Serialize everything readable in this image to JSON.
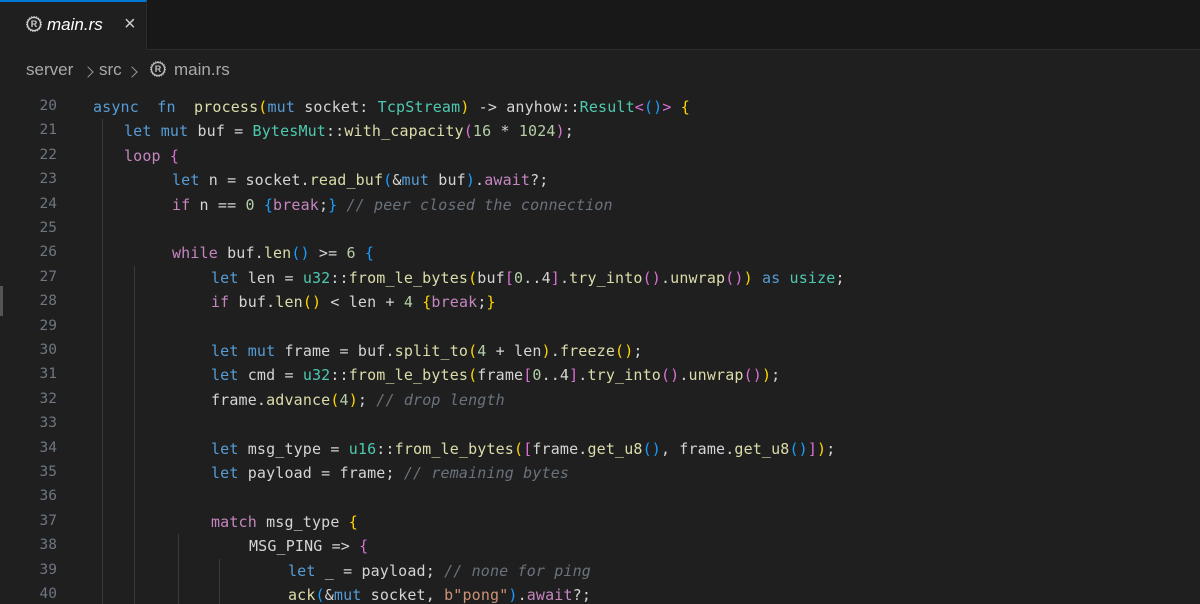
{
  "tab": {
    "filename": "main.rs",
    "close_label": "×"
  },
  "breadcrumb": {
    "items": [
      "server",
      "src",
      "main.rs"
    ]
  },
  "editor": {
    "lines": [
      {
        "n": "20",
        "indent": 0,
        "tokens": [
          [
            "kb",
            "async"
          ],
          [
            "",
            "  "
          ],
          [
            "kb",
            "fn"
          ],
          [
            "",
            "  "
          ],
          [
            "fn",
            "process"
          ],
          [
            "bY",
            "("
          ],
          [
            "kb",
            "mut"
          ],
          [
            "",
            " socket: "
          ],
          [
            "ty",
            "TcpStream"
          ],
          [
            "bY",
            ")"
          ],
          [
            "",
            " -> anyhow::"
          ],
          [
            "ty",
            "Result"
          ],
          [
            "bP",
            "<"
          ],
          [
            "bB",
            "()"
          ],
          [
            "bP",
            ">"
          ],
          [
            "",
            " "
          ],
          [
            "bY",
            "{"
          ]
        ]
      },
      {
        "n": "21",
        "indent": 1,
        "tokens": [
          [
            "kb",
            "let"
          ],
          [
            "",
            " "
          ],
          [
            "kb",
            "mut"
          ],
          [
            "",
            " buf = "
          ],
          [
            "ty",
            "BytesMut"
          ],
          [
            "",
            "::"
          ],
          [
            "fn",
            "with_capacity"
          ],
          [
            "bP",
            "("
          ],
          [
            "num",
            "16"
          ],
          [
            "",
            " * "
          ],
          [
            "num",
            "1024"
          ],
          [
            "bP",
            ")"
          ],
          [
            "",
            ";"
          ]
        ]
      },
      {
        "n": "22",
        "indent": 1,
        "tokens": [
          [
            "kw",
            "loop"
          ],
          [
            "",
            " "
          ],
          [
            "bP",
            "{"
          ]
        ]
      },
      {
        "n": "23",
        "indent": 2,
        "tokens": [
          [
            "kb",
            "let"
          ],
          [
            "",
            " n = socket."
          ],
          [
            "fn",
            "read_buf"
          ],
          [
            "bB",
            "("
          ],
          [
            "",
            "&"
          ],
          [
            "kb",
            "mut"
          ],
          [
            "",
            " buf"
          ],
          [
            "bB",
            ")"
          ],
          [
            "",
            "."
          ],
          [
            "kw",
            "await"
          ],
          [
            "",
            "?;"
          ]
        ]
      },
      {
        "n": "24",
        "indent": 2,
        "tokens": [
          [
            "kw",
            "if"
          ],
          [
            "",
            " n == "
          ],
          [
            "num",
            "0"
          ],
          [
            "",
            " "
          ],
          [
            "bB",
            "{"
          ],
          [
            "kw",
            "break"
          ],
          [
            "",
            ";"
          ],
          [
            "bB",
            "}"
          ],
          [
            "",
            " "
          ],
          [
            "cm",
            "// peer closed the connection"
          ]
        ]
      },
      {
        "n": "25",
        "indent": 0,
        "tokens": []
      },
      {
        "n": "26",
        "indent": 2,
        "tokens": [
          [
            "kw",
            "while"
          ],
          [
            "",
            " buf."
          ],
          [
            "fn",
            "len"
          ],
          [
            "bB",
            "()"
          ],
          [
            "",
            " >= "
          ],
          [
            "num",
            "6"
          ],
          [
            "",
            " "
          ],
          [
            "bB",
            "{"
          ]
        ]
      },
      {
        "n": "27",
        "indent": 3,
        "tokens": [
          [
            "kb",
            "let"
          ],
          [
            "",
            " len = "
          ],
          [
            "ty",
            "u32"
          ],
          [
            "",
            "::"
          ],
          [
            "fn",
            "from_le_bytes"
          ],
          [
            "bY",
            "("
          ],
          [
            "",
            "buf"
          ],
          [
            "bP",
            "["
          ],
          [
            "num",
            "0"
          ],
          [
            "",
            "..4"
          ],
          [
            "bP",
            "]"
          ],
          [
            "",
            "."
          ],
          [
            "fn",
            "try_into"
          ],
          [
            "bP",
            "()"
          ],
          [
            "",
            "."
          ],
          [
            "fn",
            "unwrap"
          ],
          [
            "bP",
            "()"
          ],
          [
            "bY",
            ")"
          ],
          [
            "",
            " "
          ],
          [
            "kb",
            "as"
          ],
          [
            "",
            " "
          ],
          [
            "ty",
            "usize"
          ],
          [
            "",
            ";"
          ]
        ]
      },
      {
        "n": "28",
        "indent": 3,
        "tokens": [
          [
            "kw",
            "if"
          ],
          [
            "",
            " buf."
          ],
          [
            "fn",
            "len"
          ],
          [
            "bY",
            "()"
          ],
          [
            "",
            " < len + "
          ],
          [
            "num",
            "4"
          ],
          [
            "",
            " "
          ],
          [
            "bY",
            "{"
          ],
          [
            "kw",
            "break"
          ],
          [
            "",
            ";"
          ],
          [
            "bY",
            "}"
          ]
        ]
      },
      {
        "n": "29",
        "indent": 0,
        "tokens": []
      },
      {
        "n": "30",
        "indent": 3,
        "tokens": [
          [
            "kb",
            "let"
          ],
          [
            "",
            " "
          ],
          [
            "kb",
            "mut"
          ],
          [
            "",
            " frame = buf."
          ],
          [
            "fn",
            "split_to"
          ],
          [
            "bY",
            "("
          ],
          [
            "num",
            "4"
          ],
          [
            "",
            " + len"
          ],
          [
            "bY",
            ")"
          ],
          [
            "",
            "."
          ],
          [
            "fn",
            "freeze"
          ],
          [
            "bY",
            "()"
          ],
          [
            "",
            ";"
          ]
        ]
      },
      {
        "n": "31",
        "indent": 3,
        "tokens": [
          [
            "kb",
            "let"
          ],
          [
            "",
            " cmd = "
          ],
          [
            "ty",
            "u32"
          ],
          [
            "",
            "::"
          ],
          [
            "fn",
            "from_le_bytes"
          ],
          [
            "bY",
            "("
          ],
          [
            "",
            "frame"
          ],
          [
            "bP",
            "["
          ],
          [
            "num",
            "0"
          ],
          [
            "",
            "..4"
          ],
          [
            "bP",
            "]"
          ],
          [
            "",
            "."
          ],
          [
            "fn",
            "try_into"
          ],
          [
            "bP",
            "()"
          ],
          [
            "",
            "."
          ],
          [
            "fn",
            "unwrap"
          ],
          [
            "bP",
            "()"
          ],
          [
            "bY",
            ")"
          ],
          [
            "",
            ";"
          ]
        ]
      },
      {
        "n": "32",
        "indent": 3,
        "tokens": [
          [
            "",
            "frame."
          ],
          [
            "fn",
            "advance"
          ],
          [
            "bY",
            "("
          ],
          [
            "num",
            "4"
          ],
          [
            "bY",
            ")"
          ],
          [
            "",
            "; "
          ],
          [
            "cm",
            "// drop length"
          ]
        ]
      },
      {
        "n": "33",
        "indent": 0,
        "tokens": []
      },
      {
        "n": "34",
        "indent": 3,
        "tokens": [
          [
            "kb",
            "let"
          ],
          [
            "",
            " msg_type = "
          ],
          [
            "ty",
            "u16"
          ],
          [
            "",
            "::"
          ],
          [
            "fn",
            "from_le_bytes"
          ],
          [
            "bY",
            "("
          ],
          [
            "bP",
            "["
          ],
          [
            "",
            "frame."
          ],
          [
            "fn",
            "get_u8"
          ],
          [
            "bB",
            "()"
          ],
          [
            "",
            ", frame."
          ],
          [
            "fn",
            "get_u8"
          ],
          [
            "bB",
            "()"
          ],
          [
            "bP",
            "]"
          ],
          [
            "bY",
            ")"
          ],
          [
            "",
            ";"
          ]
        ]
      },
      {
        "n": "35",
        "indent": 3,
        "tokens": [
          [
            "kb",
            "let"
          ],
          [
            "",
            " payload = frame; "
          ],
          [
            "cm",
            "// remaining bytes"
          ]
        ]
      },
      {
        "n": "36",
        "indent": 0,
        "tokens": []
      },
      {
        "n": "37",
        "indent": 3,
        "tokens": [
          [
            "kw",
            "match"
          ],
          [
            "",
            " msg_type "
          ],
          [
            "bY",
            "{"
          ]
        ]
      },
      {
        "n": "38",
        "indent": 4,
        "tokens": [
          [
            "",
            "MSG_PING => "
          ],
          [
            "bP",
            "{"
          ]
        ]
      },
      {
        "n": "39",
        "indent": 5,
        "tokens": [
          [
            "kb",
            "let"
          ],
          [
            "",
            " _ = payload; "
          ],
          [
            "cm",
            "// none for ping"
          ]
        ]
      },
      {
        "n": "40",
        "indent": 5,
        "tokens": [
          [
            "fn",
            "ack"
          ],
          [
            "bB",
            "("
          ],
          [
            "",
            "&"
          ],
          [
            "kb",
            "mut"
          ],
          [
            "",
            " socket, "
          ],
          [
            "str",
            "b\"pong\""
          ],
          [
            "bB",
            ")"
          ],
          [
            "",
            "."
          ],
          [
            "kw",
            "await"
          ],
          [
            "",
            "?;"
          ]
        ]
      }
    ]
  }
}
